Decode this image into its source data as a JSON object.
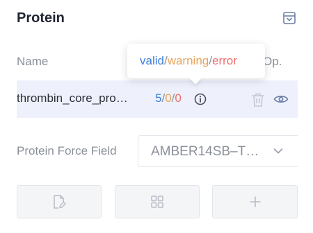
{
  "panel": {
    "title": "Protein",
    "collapse_icon": "collapse-panel-icon"
  },
  "table": {
    "columns": {
      "name": "Name",
      "op": "Op."
    },
    "rows": [
      {
        "name": "thrombin_core_pro…",
        "valid": "5",
        "warning": "0",
        "error": "0",
        "sep": "/",
        "icons": [
          "info-icon",
          "trash-icon",
          "eye-icon"
        ]
      }
    ]
  },
  "tooltip": {
    "valid": "valid",
    "warning": "warning",
    "error": "error",
    "sep": "/"
  },
  "force_field": {
    "label": "Protein Force Field",
    "value": "AMBER14SB–T…"
  },
  "actions": {
    "icons": [
      "edit-file-icon",
      "grid-icon",
      "plus-icon"
    ]
  },
  "colors": {
    "valid": "#3d7fd9",
    "warning": "#e7a45c",
    "error": "#ee6e6e",
    "row_highlight": "#eef1fb"
  }
}
